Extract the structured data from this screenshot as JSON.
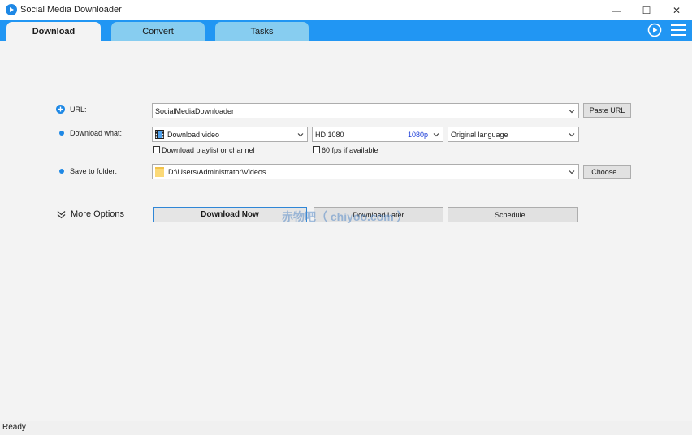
{
  "window": {
    "title": "Social Media Downloader",
    "minimize_glyph": "—",
    "maximize_glyph": "☐",
    "close_glyph": "✕"
  },
  "tabs": [
    {
      "label": "Download",
      "active": true
    },
    {
      "label": "Convert",
      "active": false
    },
    {
      "label": "Tasks",
      "active": false
    }
  ],
  "form": {
    "url": {
      "label": "URL:",
      "value": "SocialMediaDownloader",
      "paste_label": "Paste URL"
    },
    "download_what": {
      "label": "Download what:",
      "type_value": "Download video",
      "quality_value": "HD 1080",
      "quality_badge": "1080p",
      "language_value": "Original language",
      "playlist_checkbox": "Download playlist or channel",
      "fps_checkbox": "60 fps if available"
    },
    "save_to": {
      "label": "Save to folder:",
      "value": "D:\\Users\\Administrator\\Videos",
      "choose_label": "Choose..."
    }
  },
  "actions": {
    "more_options": "More Options",
    "download_now": "Download Now",
    "download_later": "Download Later",
    "schedule": "Schedule..."
  },
  "watermark": "赤物吧（ chiyoo.com ）",
  "status": "Ready",
  "colors": {
    "accent": "#2196f3",
    "tab_inactive": "#87cdf0",
    "bullet": "#1e88e5",
    "badge_text": "#1a3cd8"
  }
}
